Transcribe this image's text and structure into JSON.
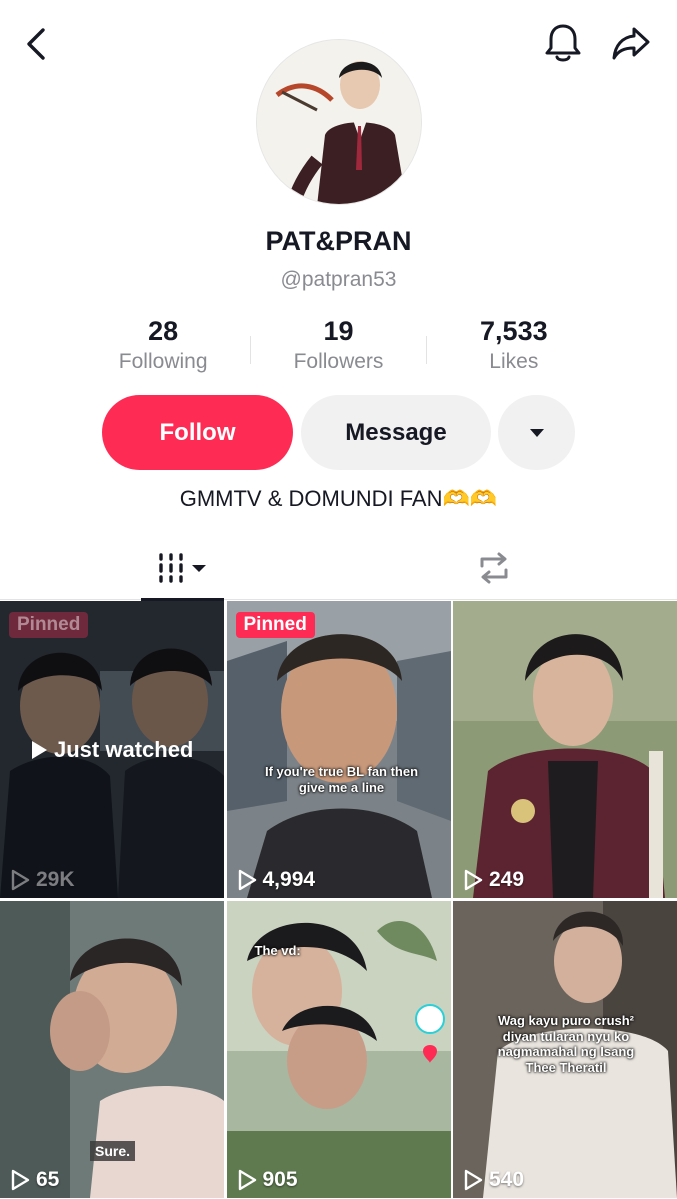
{
  "profile": {
    "name": "PAT&PRAN",
    "handle": "@patpran53",
    "bio": "GMMTV & DOMUNDI FAN🫶🫶"
  },
  "stats": [
    {
      "value": "28",
      "label": "Following"
    },
    {
      "value": "19",
      "label": "Followers"
    },
    {
      "value": "7,533",
      "label": "Likes"
    }
  ],
  "actions": {
    "follow_label": "Follow",
    "message_label": "Message"
  },
  "icons": {
    "back": "chevron-left-icon",
    "notifications": "bell-icon",
    "share": "share-arrow-icon",
    "more": "caret-down-icon",
    "videos_tab": "grid-icon",
    "reposts_tab": "repost-icon",
    "views": "play-icon"
  },
  "colors": {
    "accent": "#fe2c55",
    "text": "#161823",
    "secondary": "#8a8b91",
    "button_gray": "#f1f1f2"
  },
  "videos": [
    {
      "views": "29K",
      "pinned": "Pinned",
      "status": "Just watched"
    },
    {
      "views": "4,994",
      "pinned": "Pinned",
      "caption": "If you're true BL fan then give me a line"
    },
    {
      "views": "249"
    },
    {
      "views": "65",
      "caption": "Sure."
    },
    {
      "views": "905",
      "caption": "The vd:"
    },
    {
      "views": "540",
      "caption": "Wag kayu puro crush² diyan tularan nyu ko nagmamahal ng Isang Thee Theratil"
    }
  ]
}
